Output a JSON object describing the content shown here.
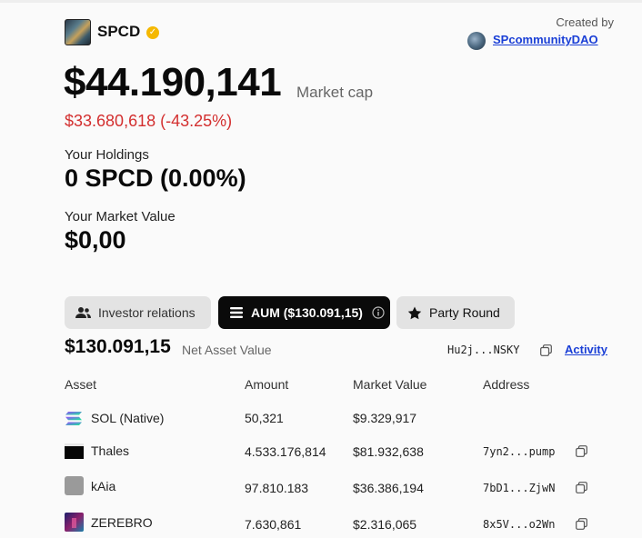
{
  "token": {
    "name": "SPCD",
    "verified_glyph": "✓",
    "logo_icon": "token-logo"
  },
  "creator": {
    "label": "Created by",
    "name": "SPcommunityDAO"
  },
  "market": {
    "cap": "$44.190,141",
    "cap_label": "Market cap",
    "change": "$33.680,618 (-43.25%)",
    "change_color": "#d32f2f"
  },
  "holdings": {
    "label": "Your Holdings",
    "value": "0 SPCD (0.00%)"
  },
  "market_value": {
    "label": "Your Market Value",
    "value": "$0,00"
  },
  "tabs": [
    {
      "label": "Investor relations",
      "icon": "users-icon",
      "active": false
    },
    {
      "label": "AUM ($130.091,15)",
      "icon": "list-icon",
      "info_icon": "info-icon",
      "active": true
    },
    {
      "label": "Party Round",
      "icon": "star-icon",
      "active": false
    }
  ],
  "aum": {
    "value": "$130.091,15",
    "label": "Net Asset Value",
    "address": "Hu2j...NSKY",
    "activity_label": "Activity"
  },
  "table": {
    "headers": [
      "Asset",
      "Amount",
      "Market Value",
      "Address"
    ],
    "rows": [
      {
        "asset": "SOL (Native)",
        "icon": "solana-icon",
        "amount": "50,321",
        "value": "$9.329,917",
        "address": ""
      },
      {
        "asset": "Thales",
        "icon": "thales-icon",
        "amount": "4.533.176,814",
        "value": "$81.932,638",
        "address": "7yn2...pump"
      },
      {
        "asset": "kAia",
        "icon": "kaia-icon",
        "amount": "97.810.183",
        "value": "$36.386,194",
        "address": "7bD1...ZjwN"
      },
      {
        "asset": "ZEREBRO",
        "icon": "zerebro-icon",
        "amount": "7.630,861",
        "value": "$2.316,065",
        "address": "8x5V...o2Wn"
      }
    ]
  },
  "colors": {
    "link": "#1a3fd6",
    "accent_active_tab": "#0a0a0a",
    "verified": "#f5b800"
  }
}
